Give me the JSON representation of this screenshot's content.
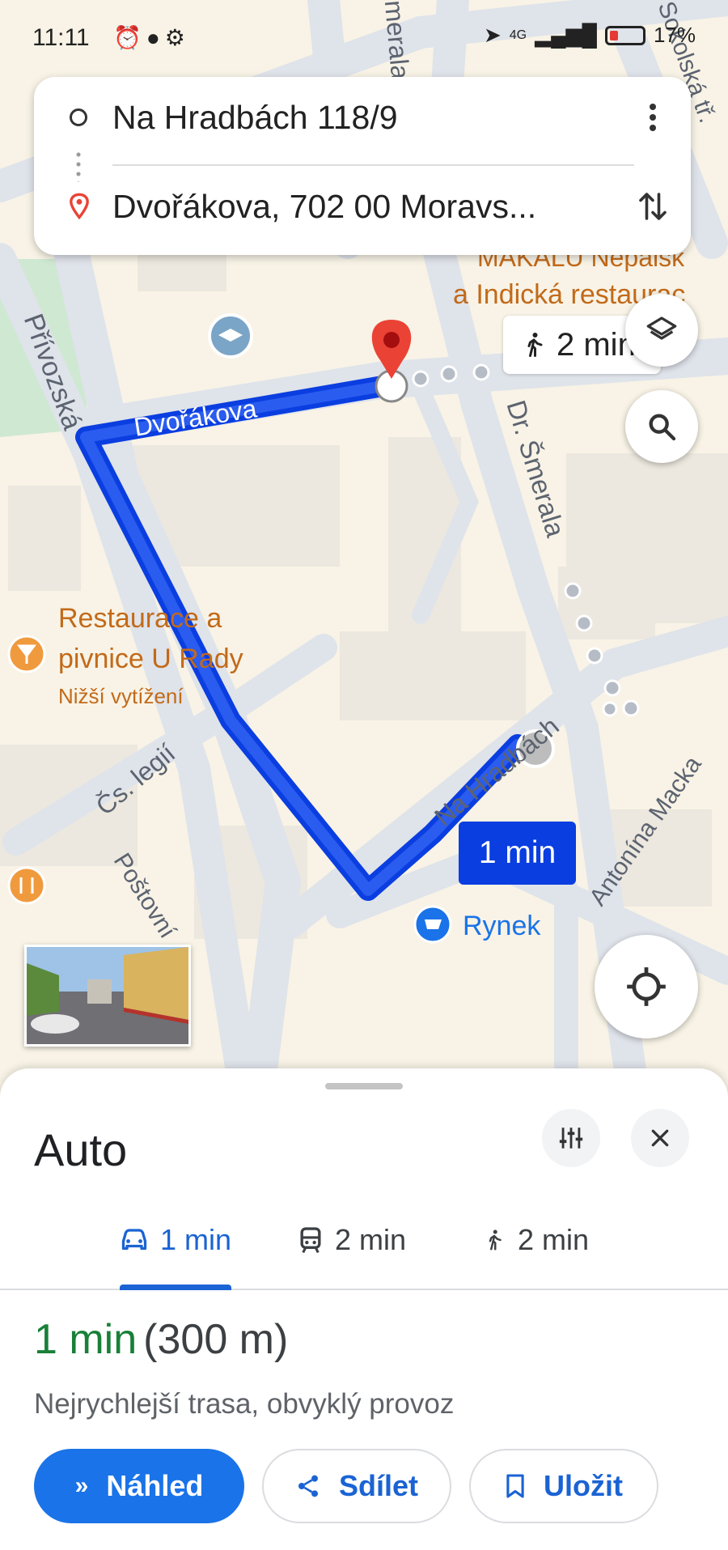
{
  "status_bar": {
    "time": "11:11",
    "network": "4G",
    "battery": "17%"
  },
  "search": {
    "origin": "Na Hradbách 118/9",
    "destination": "Dvořákova, 702 00 Moravs..."
  },
  "map": {
    "streets": {
      "privozska": "Přívozská",
      "dvorakova": "Dvořákova",
      "smerala": "Dr. Šmerala",
      "smerala_top": "Smerala",
      "sokolska": "Sokolská tř.",
      "cs_legii": "Čs. legií",
      "postovni": "Poštovní",
      "na_hradbach": "Na Hradbách",
      "antonina": "Antonína Macka"
    },
    "places": {
      "restaurant_name_1": "Restaurace a",
      "restaurant_name_2": "pivnice U Rady",
      "restaurant_status": "Nižší vytížení",
      "makalu_1": "MAKALU Nepalsk",
      "makalu_2": "a Indická restaurac",
      "store": "Rynek"
    },
    "walk_chip": "2 min",
    "route_label": "1 min"
  },
  "sheet": {
    "title": "Auto",
    "modes": [
      {
        "icon": "car-icon",
        "label": "1 min",
        "active": true
      },
      {
        "icon": "transit-icon",
        "label": "2 min",
        "active": false
      },
      {
        "icon": "walk-icon",
        "label": "2 min",
        "active": false
      }
    ],
    "summary": {
      "time": "1 min",
      "distance": "(300 m)"
    },
    "description": "Nejrychlejší trasa, obvyklý provoz",
    "buttons": {
      "preview": "Náhled",
      "share": "Sdílet",
      "save": "Uložit"
    }
  },
  "colors": {
    "route": "#0a3ee0",
    "accent": "#1a73e8",
    "time_green": "#188038",
    "pin_red": "#ea4335"
  }
}
